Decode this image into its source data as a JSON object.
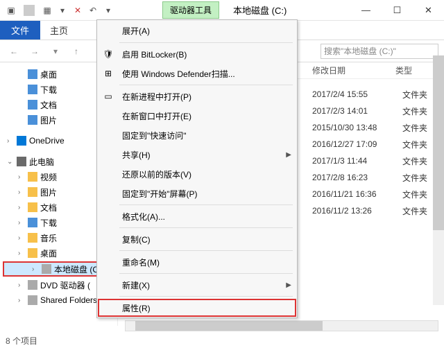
{
  "titlebar": {
    "tool_tab": "驱动器工具",
    "title": "本地磁盘 (C:)"
  },
  "ribbon": {
    "file": "文件",
    "home": "主页"
  },
  "search": {
    "placeholder": "搜索\"本地磁盘 (C:)\""
  },
  "tree": {
    "desktop": "桌面",
    "downloads": "下载",
    "documents": "文档",
    "pictures": "图片",
    "onedrive": "OneDrive",
    "thispc": "此电脑",
    "videos": "视频",
    "pictures2": "图片",
    "documents2": "文档",
    "downloads2": "下载",
    "music": "音乐",
    "desktop2": "桌面",
    "localc": "本地磁盘 (C:)",
    "dvd": "DVD 驱动器 (",
    "shared": "Shared Folders"
  },
  "columns": {
    "date": "修改日期",
    "type": "类型"
  },
  "rows": [
    {
      "date": "2017/2/4 15:55",
      "type": "文件夹"
    },
    {
      "date": "2017/2/3 14:01",
      "type": "文件夹"
    },
    {
      "date": "2015/10/30 13:48",
      "type": "文件夹"
    },
    {
      "date": "2016/12/27 17:09",
      "type": "文件夹"
    },
    {
      "date": "2017/1/3 11:44",
      "type": "文件夹"
    },
    {
      "date": "2017/2/8 16:23",
      "type": "文件夹"
    },
    {
      "date": "2016/11/21 16:36",
      "type": "文件夹"
    },
    {
      "date": "2016/11/2 13:26",
      "type": "文件夹"
    }
  ],
  "ctx": {
    "expand": "展开(A)",
    "bitlocker": "启用 BitLocker(B)",
    "defender": "使用 Windows Defender扫描...",
    "newproc": "在新进程中打开(P)",
    "newwin": "在新窗口中打开(E)",
    "pinquick": "固定到\"快速访问\"",
    "share": "共享(H)",
    "restore": "还原以前的版本(V)",
    "pinstart": "固定到\"开始\"屏幕(P)",
    "format": "格式化(A)...",
    "copy": "复制(C)",
    "rename": "重命名(M)",
    "new": "新建(X)",
    "properties": "属性(R)"
  },
  "status": {
    "items": "8 个项目"
  }
}
